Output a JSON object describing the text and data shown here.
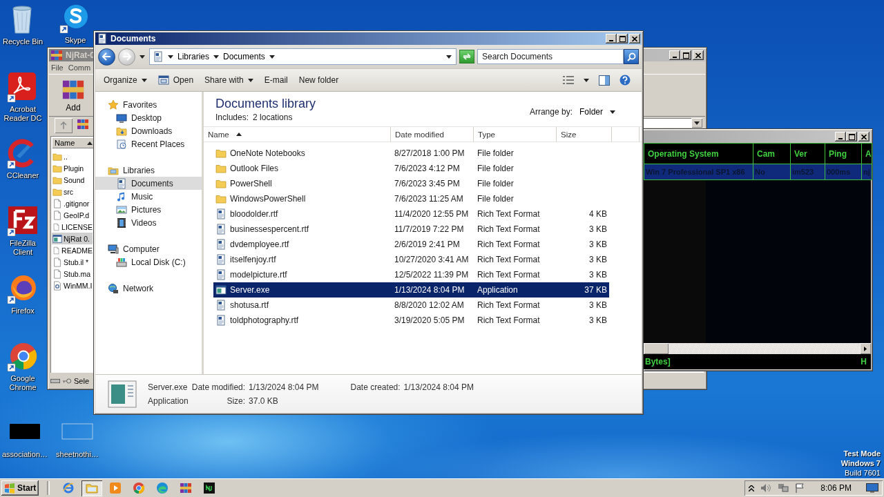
{
  "desktop_icons": [
    {
      "label": "Recycle Bin",
      "kind": "recycle_bin"
    },
    {
      "label": "Skype",
      "kind": "skype"
    },
    {
      "label": "Acrobat Reader DC",
      "kind": "acrobat"
    },
    {
      "label": "CCleaner",
      "kind": "ccleaner"
    },
    {
      "label": "FileZilla Client",
      "kind": "filezilla"
    },
    {
      "label": "Firefox",
      "kind": "firefox"
    },
    {
      "label": "Google Chrome",
      "kind": "chrome"
    },
    {
      "label": "association…",
      "kind": "black_file"
    },
    {
      "label": "sheetnothi…",
      "kind": "blank_file"
    }
  ],
  "archive_window": {
    "title": "NjRat-0",
    "menu": [
      "File",
      "Comm"
    ],
    "toolbar": [
      "Add"
    ],
    "column": "Name",
    "status": "Sele",
    "files": [
      {
        "name": "..",
        "kind": "folder",
        "selected": false
      },
      {
        "name": "Plugin",
        "kind": "folder",
        "selected": false
      },
      {
        "name": "Sound",
        "kind": "folder",
        "selected": false
      },
      {
        "name": "src",
        "kind": "folder",
        "selected": false
      },
      {
        "name": ".gitignor",
        "kind": "file",
        "selected": false
      },
      {
        "name": "GeoIP.d",
        "kind": "file",
        "selected": false
      },
      {
        "name": "LICENSE",
        "kind": "file",
        "selected": false
      },
      {
        "name": "NjRat 0.",
        "kind": "exe",
        "selected": true
      },
      {
        "name": "README",
        "kind": "file",
        "selected": false
      },
      {
        "name": "Stub.il *",
        "kind": "file",
        "selected": false
      },
      {
        "name": "Stub.ma",
        "kind": "file",
        "selected": false
      },
      {
        "name": "WinMM.I",
        "kind": "dll",
        "selected": false
      }
    ]
  },
  "rat_window": {
    "columns": [
      "Operating System",
      "Cam",
      "Ver",
      "Ping",
      "A"
    ],
    "rows": [
      {
        "cells": [
          "Win 7 Professional SP1 x86",
          "No",
          "im523",
          "000ms",
          "nj"
        ],
        "selected": true
      }
    ],
    "status_left": "Bytes]",
    "status_right": "H"
  },
  "explorer": {
    "title": "Documents",
    "breadcrumb": [
      "Libraries",
      "Documents"
    ],
    "search": {
      "placeholder": "Search Documents"
    },
    "toolbar": [
      {
        "label": "Organize",
        "kind": "menu"
      },
      {
        "label": "Open",
        "kind": "open"
      },
      {
        "label": "Share with",
        "kind": "menu"
      },
      {
        "label": "E-mail",
        "kind": "plain"
      },
      {
        "label": "New folder",
        "kind": "plain"
      }
    ],
    "nav": [
      {
        "label": "Favorites",
        "kind": "favorites",
        "children": [
          {
            "label": "Desktop",
            "kind": "desktop",
            "selected": false
          },
          {
            "label": "Downloads",
            "kind": "downloads",
            "selected": false
          },
          {
            "label": "Recent Places",
            "kind": "recent",
            "selected": false
          }
        ]
      },
      {
        "label": "Libraries",
        "kind": "libraries",
        "children": [
          {
            "label": "Documents",
            "kind": "documents",
            "selected": true
          },
          {
            "label": "Music",
            "kind": "music",
            "selected": false
          },
          {
            "label": "Pictures",
            "kind": "pictures",
            "selected": false
          },
          {
            "label": "Videos",
            "kind": "videos",
            "selected": false
          }
        ]
      },
      {
        "label": "Computer",
        "kind": "computer",
        "children": [
          {
            "label": "Local Disk (C:)",
            "kind": "disk",
            "selected": false
          }
        ]
      },
      {
        "label": "Network",
        "kind": "network"
      }
    ],
    "library": {
      "title": "Documents library",
      "includes_label": "Includes:",
      "includes": "2 locations",
      "arrange_label": "Arrange by:",
      "arrange": "Folder"
    },
    "columns": [
      "Name",
      "Date modified",
      "Type",
      "Size"
    ],
    "files": [
      {
        "name": "OneNote Notebooks",
        "date": "8/27/2018 1:00 PM",
        "type": "File folder",
        "kind": "folder",
        "selected": false
      },
      {
        "name": "Outlook Files",
        "date": "7/6/2023 4:12 PM",
        "type": "File folder",
        "kind": "folder",
        "selected": false
      },
      {
        "name": "PowerShell",
        "date": "7/6/2023 3:45 PM",
        "type": "File folder",
        "kind": "folder",
        "selected": false
      },
      {
        "name": "WindowsPowerShell",
        "date": "7/6/2023 11:25 AM",
        "type": "File folder",
        "kind": "folder",
        "selected": false
      },
      {
        "name": "bloodolder.rtf",
        "date": "11/4/2020 12:55 PM",
        "type": "Rich Text Format",
        "size": "4 KB",
        "kind": "rtf",
        "selected": false
      },
      {
        "name": "businessespercent.rtf",
        "date": "11/7/2019 7:22 PM",
        "type": "Rich Text Format",
        "size": "3 KB",
        "kind": "rtf",
        "selected": false
      },
      {
        "name": "dvdemployee.rtf",
        "date": "2/6/2019 2:41 PM",
        "type": "Rich Text Format",
        "size": "3 KB",
        "kind": "rtf",
        "selected": false
      },
      {
        "name": "itselfenjoy.rtf",
        "date": "10/27/2020 3:41 AM",
        "type": "Rich Text Format",
        "size": "3 KB",
        "kind": "rtf",
        "selected": false
      },
      {
        "name": "modelpicture.rtf",
        "date": "12/5/2022 11:39 PM",
        "type": "Rich Text Format",
        "size": "3 KB",
        "kind": "rtf",
        "selected": false
      },
      {
        "name": "Server.exe",
        "date": "1/13/2024 8:04 PM",
        "type": "Application",
        "size": "37 KB",
        "kind": "exe",
        "selected": true
      },
      {
        "name": "shotusa.rtf",
        "date": "8/8/2020 12:02 AM",
        "type": "Rich Text Format",
        "size": "3 KB",
        "kind": "rtf",
        "selected": false
      },
      {
        "name": "toldphotography.rtf",
        "date": "3/19/2020 5:05 PM",
        "type": "Rich Text Format",
        "size": "3 KB",
        "kind": "rtf",
        "selected": false
      }
    ],
    "details": {
      "name": "Server.exe",
      "type": "Application",
      "fields": [
        {
          "label": "Date modified:",
          "value": "1/13/2024 8:04 PM"
        },
        {
          "label": "Size:",
          "value": "37.0 KB"
        },
        {
          "label": "Date created:",
          "value": "1/13/2024 8:04 PM"
        }
      ]
    }
  },
  "os_info": [
    {
      "text": "Test Mode",
      "emphasis": true
    },
    {
      "text": "Windows 7",
      "emphasis": true
    },
    {
      "text": "Build 7601",
      "emphasis": false
    }
  ],
  "taskbar": {
    "start": "Start",
    "clock": "8:06 PM",
    "apps": [
      {
        "kind": "ie",
        "selected": false
      },
      {
        "kind": "explorer",
        "selected": true
      },
      {
        "kind": "media",
        "selected": false
      },
      {
        "kind": "chrome",
        "selected": false
      },
      {
        "kind": "edge",
        "selected": false
      },
      {
        "kind": "winrar",
        "selected": false
      },
      {
        "kind": "njrat",
        "selected": false
      }
    ]
  }
}
